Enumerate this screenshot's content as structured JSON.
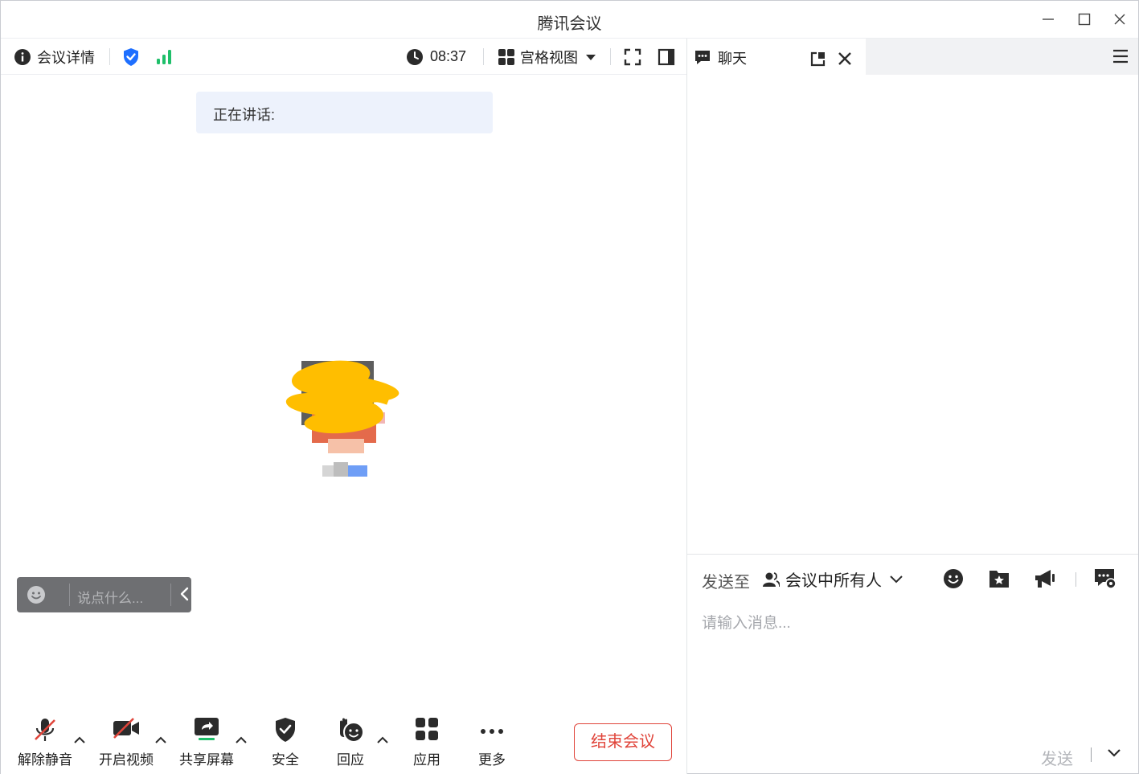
{
  "window": {
    "title": "腾讯会议"
  },
  "toolbar": {
    "meeting_info": "会议详情",
    "timer": "08:37",
    "view_mode": "宫格视图",
    "colors": {
      "shield": "#1e6fff",
      "signal": "#1fbf6a"
    }
  },
  "stage": {
    "speaking_label": "正在讲话:",
    "quick_chat_placeholder": "说点什么..."
  },
  "bottom_bar": {
    "unmute": "解除静音",
    "start_video": "开启视频",
    "share_screen": "共享屏幕",
    "security": "安全",
    "reactions": "回应",
    "apps": "应用",
    "more": "更多",
    "end_meeting": "结束会议",
    "colors": {
      "end": "#e0443a",
      "share": "#1fbf6a",
      "muted": "#e0443a"
    }
  },
  "chat": {
    "tab_label": "聊天",
    "send_to_label": "发送至",
    "target": "会议中所有人",
    "input_placeholder": "请输入消息...",
    "send_label": "发送"
  }
}
